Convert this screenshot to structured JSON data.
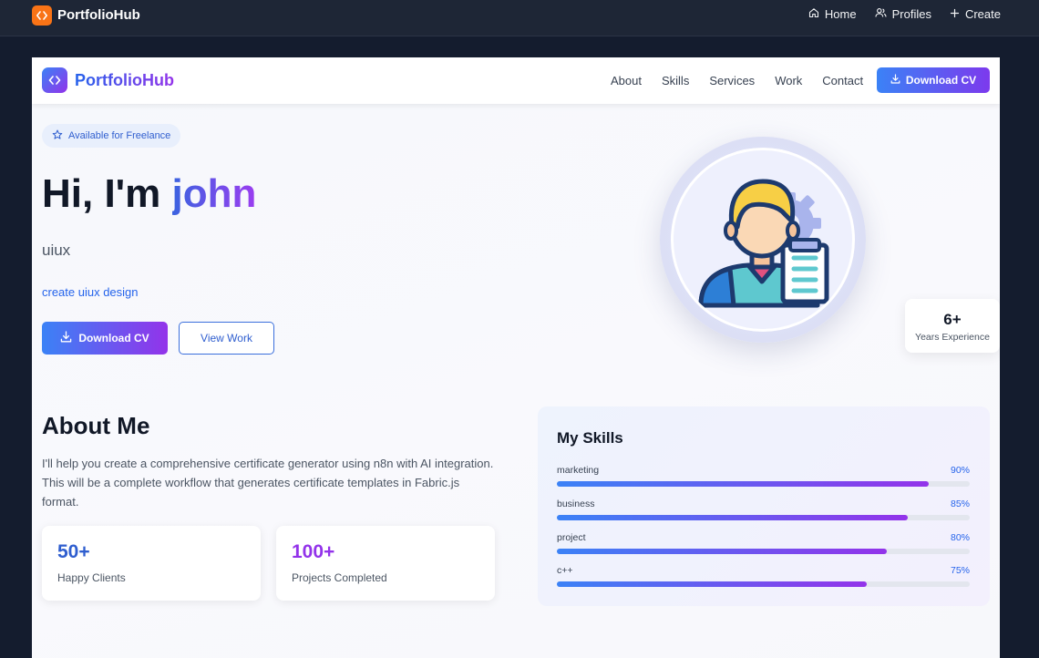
{
  "appbar": {
    "brand": "PortfolioHub",
    "nav": [
      {
        "label": "Home",
        "icon": "home-icon"
      },
      {
        "label": "Profiles",
        "icon": "users-icon"
      },
      {
        "label": "Create",
        "icon": "plus-icon"
      }
    ]
  },
  "site": {
    "brand": "PortfolioHub",
    "links": [
      "About",
      "Skills",
      "Services",
      "Work",
      "Contact"
    ],
    "download_cv": "Download CV"
  },
  "hero": {
    "badge": "Available for Freelance",
    "greeting": "Hi, I'm",
    "name": "john",
    "role": "uiux",
    "tagline": "create uiux design",
    "primary_button": "Download CV",
    "secondary_button": "View Work",
    "experience_value": "6+",
    "experience_label": "Years Experience"
  },
  "about": {
    "title": "About Me",
    "text": "I'll help you create a comprehensive certificate generator using n8n with AI integration. This will be a complete workflow that generates certificate templates in Fabric.js format.",
    "stats": [
      {
        "value": "50+",
        "label": "Happy Clients",
        "color": "#2f5ecf"
      },
      {
        "value": "100+",
        "label": "Projects Completed",
        "color": "#9333ea"
      }
    ]
  },
  "skills": {
    "title": "My Skills",
    "items": [
      {
        "name": "marketing",
        "percent_label": "90%",
        "percent": 90
      },
      {
        "name": "business",
        "percent_label": "85%",
        "percent": 85
      },
      {
        "name": "project",
        "percent_label": "80%",
        "percent": 80
      },
      {
        "name": "c++",
        "percent_label": "75%",
        "percent": 75
      }
    ]
  },
  "colors": {
    "appbar_bg": "#1e2636",
    "brand_orange": "#f97316",
    "accent_blue": "#3b82f6",
    "accent_purple": "#9333ea"
  }
}
